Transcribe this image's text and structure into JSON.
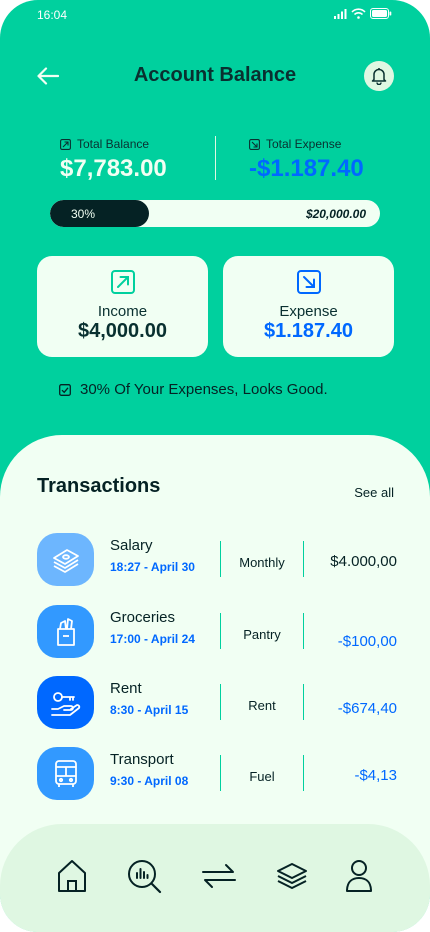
{
  "status_bar": {
    "time": "16:04"
  },
  "header": {
    "title": "Account Balance"
  },
  "summary": {
    "total_balance_label": "Total Balance",
    "total_balance_value": "$7,783.00",
    "total_expense_label": "Total Expense",
    "total_expense_value": "-$1.187.40",
    "progress_percent_label": "30%",
    "progress_fraction": 0.3,
    "progress_goal": "$20,000.00"
  },
  "cards": {
    "income": {
      "label": "Income",
      "value": "$4,000.00"
    },
    "expense": {
      "label": "Expense",
      "value": "$1.187.40"
    }
  },
  "note": "30% Of Your Expenses, Looks Good.",
  "transactions": {
    "title": "Transactions",
    "see_all": "See all",
    "items": [
      {
        "name": "Salary",
        "time": "18:27 - April 30",
        "category": "Monthly",
        "amount": "$4.000,00",
        "icon": "money-stack-icon"
      },
      {
        "name": "Groceries",
        "time": "17:00 - April 24",
        "category": "Pantry",
        "amount": "-$100,00",
        "icon": "grocery-bag-icon"
      },
      {
        "name": "Rent",
        "time": "8:30 - April 15",
        "category": "Rent",
        "amount": "-$674,40",
        "icon": "key-hand-icon"
      },
      {
        "name": "Transport",
        "time": "9:30 - April 08",
        "category": "Fuel",
        "amount": "-$4,13",
        "icon": "bus-icon"
      }
    ]
  },
  "nav": [
    "home-icon",
    "analysis-icon",
    "transfer-icon",
    "layers-icon",
    "profile-icon"
  ],
  "colors": {
    "primary_green": "#00d09e",
    "light_surface": "#f1fff3",
    "nav_surface": "#dff7e2",
    "dark_text": "#052224",
    "accent_blue": "#0068ff",
    "icon_light_blue": "#6db6fe",
    "icon_mid_blue": "#3299ff",
    "icon_dark_blue": "#0068ff"
  }
}
